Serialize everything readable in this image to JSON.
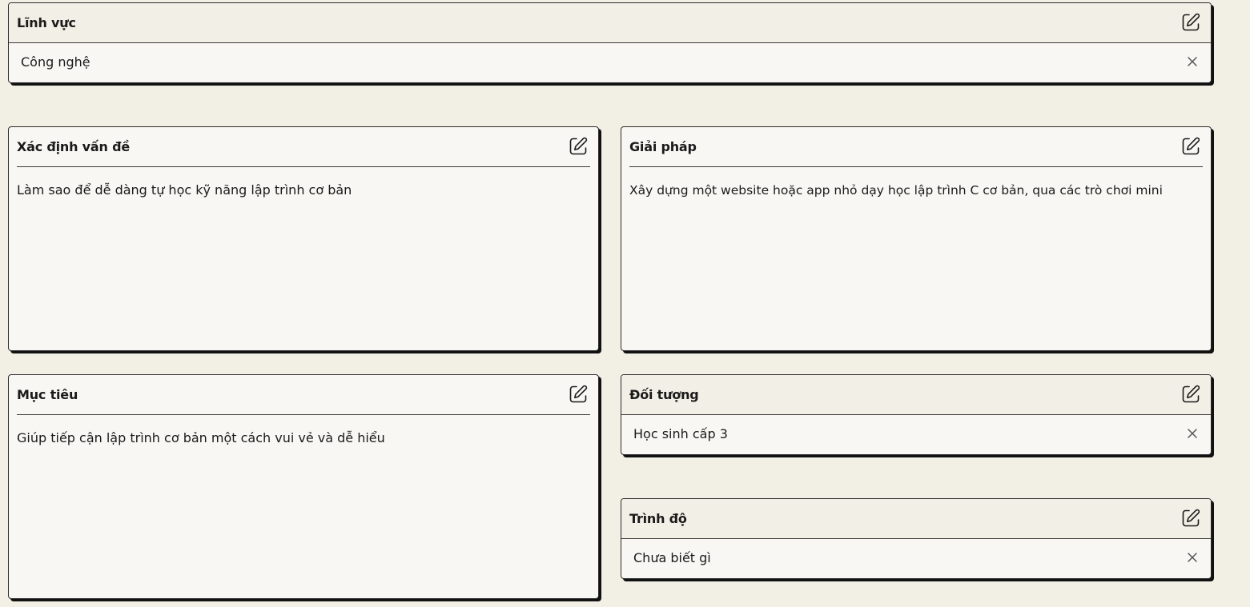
{
  "field": {
    "title": "Lĩnh vực",
    "value": "Công nghệ"
  },
  "problem": {
    "title": "Xác định vấn đề",
    "text": "Làm sao để dễ dàng tự học kỹ năng lập trình cơ bản"
  },
  "solution": {
    "title": "Giải pháp",
    "text": "Xây dựng một website hoặc app nhỏ dạy học lập trình C cơ bản, qua các trò chơi mini"
  },
  "goal": {
    "title": "Mục tiêu",
    "text": "Giúp tiếp cận lập trình cơ bản một cách vui vẻ và dễ hiểu"
  },
  "audience": {
    "title": "Đối tượng",
    "value": "Học sinh cấp 3"
  },
  "level": {
    "title": "Trình độ",
    "value": "Chưa biết gì"
  },
  "icons": {
    "edit": "edit-pencil-icon",
    "remove": "close-x-icon"
  },
  "colors": {
    "background": "#f2efe4",
    "card": "#f8f7f3",
    "border": "#2b2b2b",
    "shadow": "#111111"
  }
}
